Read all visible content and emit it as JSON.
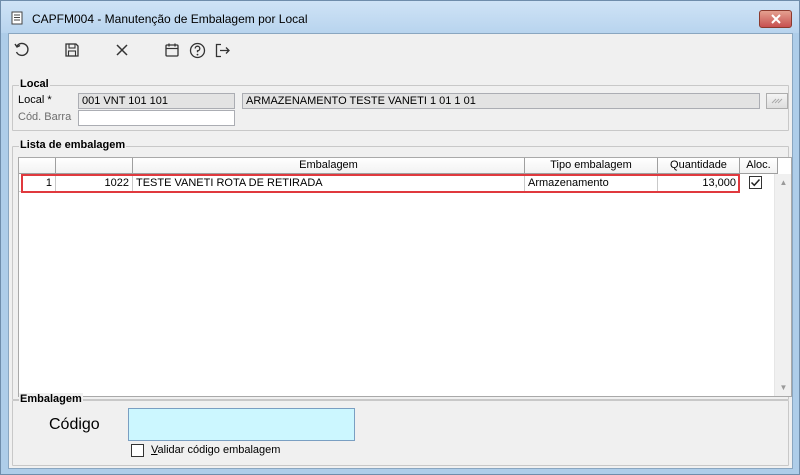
{
  "window": {
    "title": "CAPFM004 - Manutenção de Embalagem por Local"
  },
  "toolbar": {
    "buttons": [
      {
        "icon": "refresh-icon"
      },
      {
        "icon": "save-icon"
      },
      {
        "icon": "close-x-icon"
      },
      {
        "icon": "calendar-icon"
      },
      {
        "icon": "help-icon"
      },
      {
        "icon": "exit-icon"
      }
    ]
  },
  "local": {
    "group_label": "Local",
    "local_label": "Local *",
    "local_code": "001 VNT 101 101",
    "local_description": "ARMAZENAMENTO TESTE VANETI 1 01 1 01",
    "cod_barra_label": "Cód. Barra",
    "cod_barra_value": ""
  },
  "lista": {
    "group_label": "Lista de embalagem",
    "columns": [
      "",
      "",
      "Embalagem",
      "Tipo embalagem",
      "Quantidade",
      "Aloc."
    ],
    "rows": [
      {
        "seq": "1",
        "codigo": "1022",
        "embalagem": "TESTE VANETI ROTA DE RETIRADA",
        "tipo": "Armazenamento",
        "quantidade": "13,000",
        "aloc": true
      }
    ]
  },
  "embalagem": {
    "group_label": "Embalagem",
    "codigo_label": "Código",
    "codigo_value": "",
    "validar_label": "Validar código embalagem",
    "validar_checked": false
  },
  "colors": {
    "highlight": "#e0393e",
    "codigo_bg": "#ccf7ff",
    "title_bar": "#b8d4ee"
  }
}
